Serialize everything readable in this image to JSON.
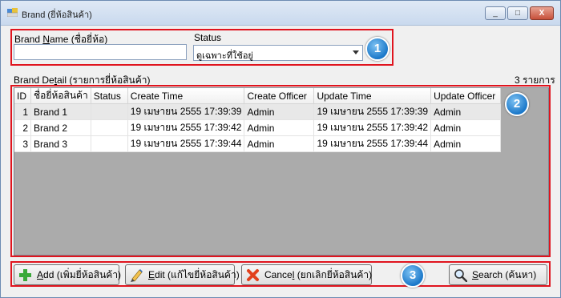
{
  "window": {
    "title": "Brand (ยี่ห้อสินค้า)",
    "controls": [
      "_",
      "□",
      "X"
    ]
  },
  "filter": {
    "brand_name_prefix": "Brand ",
    "brand_name_access": "N",
    "brand_name_suffix": "ame (ชื่อยี่ห้อ)",
    "brand_name_value": "",
    "status_label": "Status",
    "status_selected": "ดูเฉพาะที่ใช้อยู่"
  },
  "detail": {
    "label_prefix": "Brand De",
    "label_access": "t",
    "label_suffix": "ail (รายการยี่ห้อสินค้า)",
    "count_text": "3 รายการ"
  },
  "table": {
    "columns": [
      "ID",
      "ชื่อยี่ห้อสินค้า",
      "Status",
      "Create Time",
      "Create Officer",
      "Update Time",
      "Update Officer"
    ],
    "rows": [
      {
        "id": "1",
        "name": "Brand 1",
        "status": "",
        "create_time": "19 เมษายน 2555 17:39:39",
        "create_officer": "Admin",
        "update_time": "19 เมษายน 2555 17:39:39",
        "update_officer": "Admin"
      },
      {
        "id": "2",
        "name": "Brand 2",
        "status": "",
        "create_time": "19 เมษายน 2555 17:39:42",
        "create_officer": "Admin",
        "update_time": "19 เมษายน 2555 17:39:42",
        "update_officer": "Admin"
      },
      {
        "id": "3",
        "name": "Brand 3",
        "status": "",
        "create_time": "19 เมษายน 2555 17:39:44",
        "create_officer": "Admin",
        "update_time": "19 เมษายน 2555 17:39:44",
        "update_officer": "Admin"
      }
    ]
  },
  "buttons": {
    "add_access": "A",
    "add_rest": "dd (เพิ่มยี่ห้อสินค้า)",
    "edit_access": "E",
    "edit_rest": "dit (แก้ไขยี่ห้อสินค้า)",
    "cancel_prefix": "Cance",
    "cancel_access": "l",
    "cancel_rest": " (ยกเลิกยี่ห้อสินค้า)",
    "search_access": "S",
    "search_rest": "earch (ค้นหา)"
  },
  "badges": [
    "1",
    "2",
    "3"
  ],
  "colors": {
    "highlight_border": "#e0141e",
    "badge_blue": "#1b78c9",
    "add_icon": "#3aa93a",
    "cancel_icon": "#e2401c"
  }
}
